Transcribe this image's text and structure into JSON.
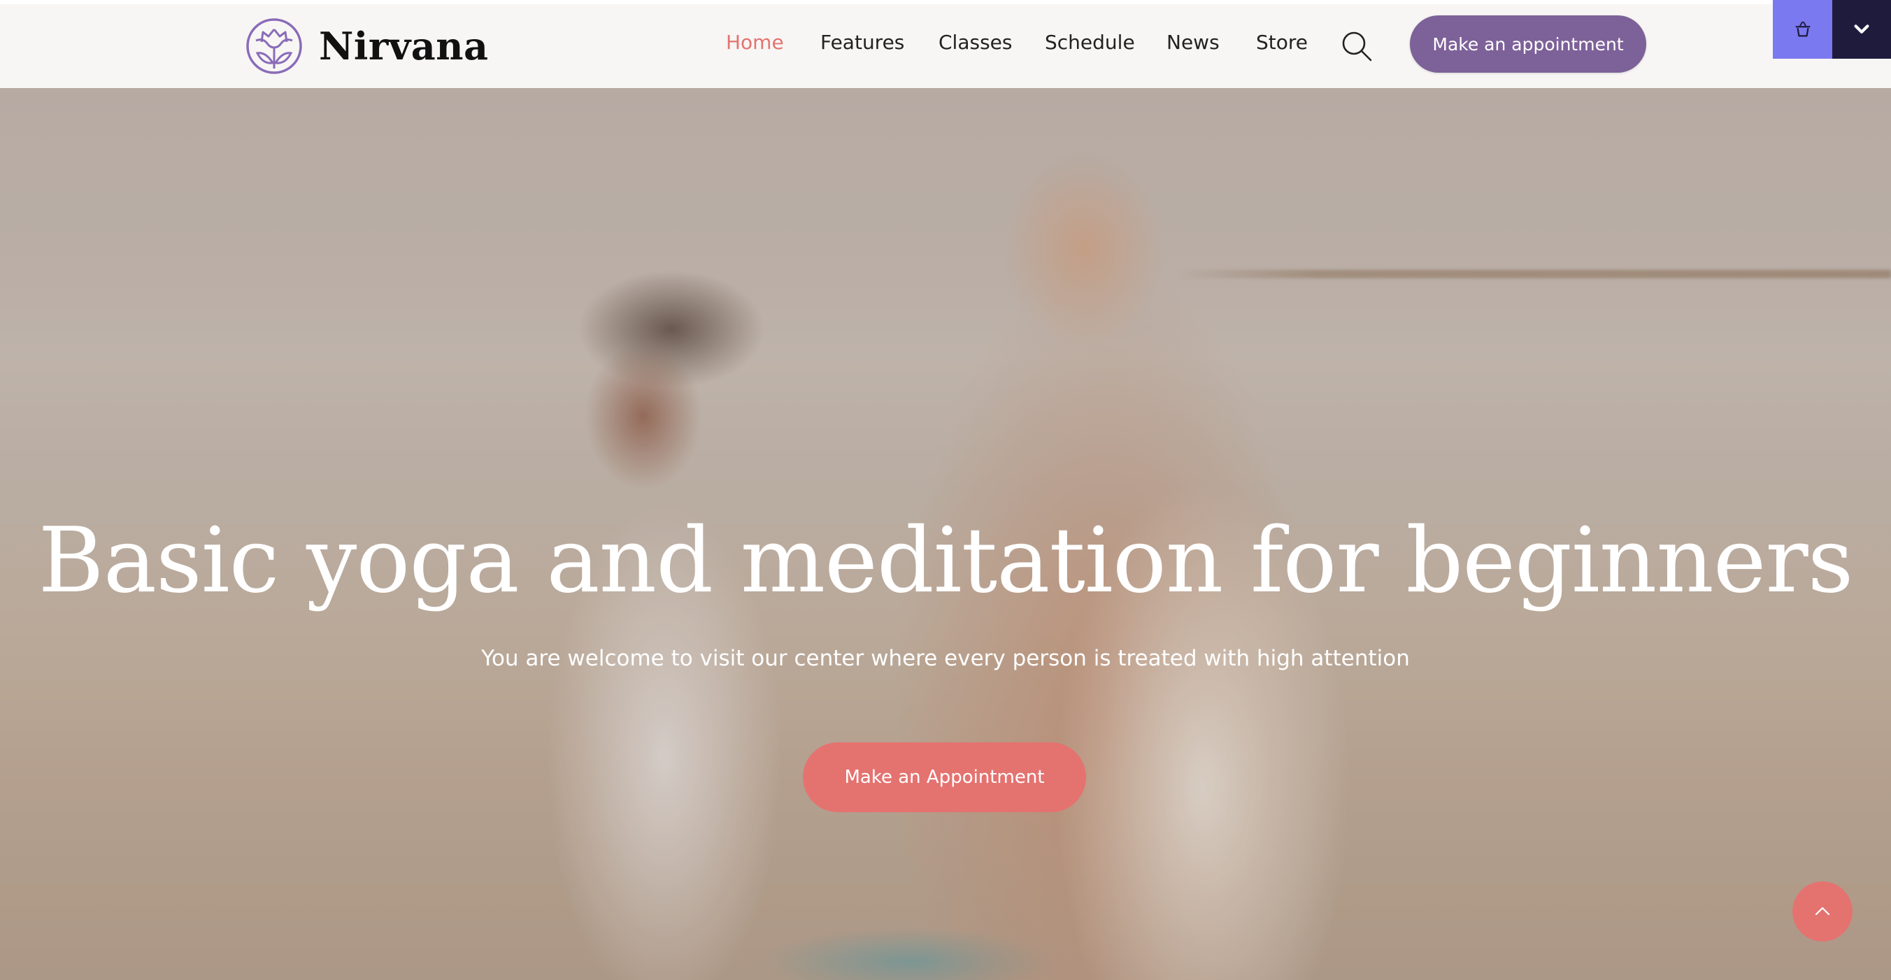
{
  "header": {
    "brand": "Nirvana",
    "logo_icon": "lotus-icon",
    "nav": [
      {
        "label": "Home",
        "active": true
      },
      {
        "label": "Features",
        "active": false
      },
      {
        "label": "Classes",
        "active": false
      },
      {
        "label": "Schedule",
        "active": false
      },
      {
        "label": "News",
        "active": false
      },
      {
        "label": "Store",
        "active": false
      }
    ],
    "search_icon": "search-icon",
    "appointment_button": "Make an appointment",
    "cart_icon": "basket-icon",
    "menu_icon": "chevron-down-icon"
  },
  "hero": {
    "title": "Basic yoga and meditation for beginners",
    "subtitle": "You are welcome to visit our center where every person is treated with high attention",
    "cta_button": "Make an Appointment",
    "scroll_top_icon": "chevron-up-icon"
  },
  "colors": {
    "accent_coral": "#e47370",
    "brand_purple": "#7d6199",
    "cart_blue": "#7b79ef",
    "menu_navy": "#1e1b3d",
    "header_bg": "#f7f6f4"
  }
}
